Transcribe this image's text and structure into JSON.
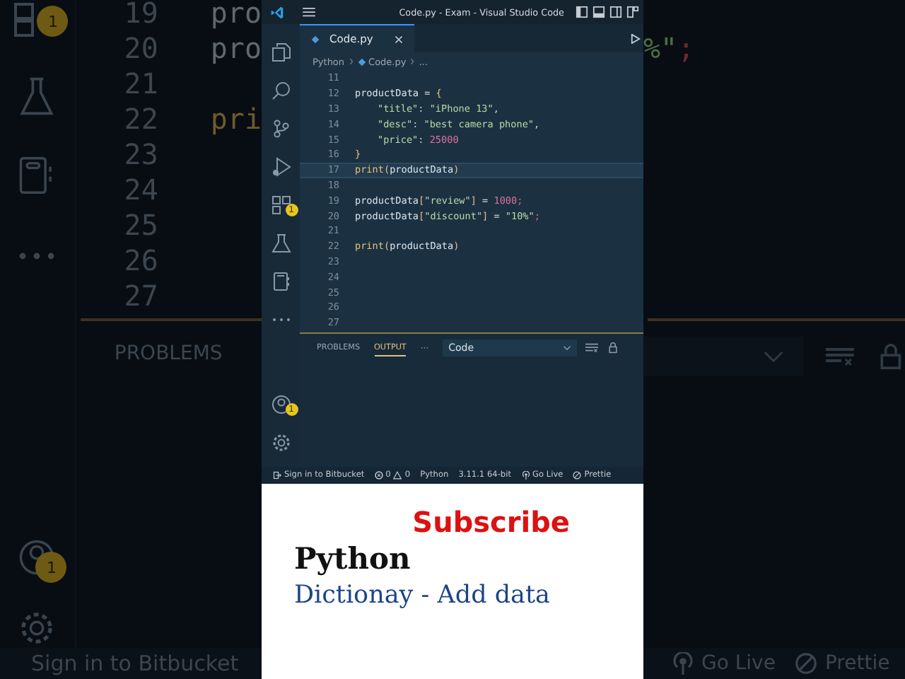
{
  "backdrop": {
    "left": {
      "badges": [
        "1",
        "1"
      ],
      "lines": [
        {
          "number": "19",
          "code": "pro",
          "kind": "id"
        },
        {
          "number": "20",
          "code": "pro",
          "kind": "id"
        },
        {
          "number": "21"
        },
        {
          "number": "22",
          "code": "pri",
          "kind": "fn"
        },
        {
          "number": "23"
        },
        {
          "number": "24"
        },
        {
          "number": "25"
        },
        {
          "number": "26"
        },
        {
          "number": "27"
        }
      ],
      "panel_tab": "PROBLEMS",
      "status": "Sign in to Bitbucket"
    },
    "right": {
      "code": [
        {
          "text": "%\"",
          "kind": "str"
        },
        {
          "text": ";",
          "kind": "err"
        }
      ],
      "status": [
        "Go Live",
        "Prettie"
      ]
    }
  },
  "window": {
    "title": "Code.py - Exam - Visual Studio Code"
  },
  "activity_bar": [
    {
      "kind": "files"
    },
    {
      "kind": "search"
    },
    {
      "kind": "source-control"
    },
    {
      "kind": "run"
    },
    {
      "kind": "extensions",
      "badge": "1"
    },
    {
      "kind": "testing"
    },
    {
      "kind": "notebook"
    },
    {
      "kind": "more"
    }
  ],
  "activity_bottom": [
    {
      "kind": "account",
      "badge": "1"
    },
    {
      "kind": "settings"
    }
  ],
  "tabs": [
    {
      "label": "Code.py",
      "selected": true
    }
  ],
  "breadcrumb": [
    "Python",
    "Code.py",
    "..."
  ],
  "editor": {
    "lines": [
      {
        "number": "11",
        "selected": false
      },
      {
        "number": "12",
        "selected": false,
        "indent": false,
        "tokens": [
          {
            "t": "productData",
            "kind": "id"
          },
          {
            "t": " = ",
            "kind": "op"
          },
          {
            "t": "{",
            "kind": "br"
          }
        ]
      },
      {
        "number": "13",
        "selected": false,
        "indent": true,
        "tokens": [
          {
            "t": "\"title\"",
            "kind": "str"
          },
          {
            "t": ": ",
            "kind": "op"
          },
          {
            "t": "\"iPhone 13\"",
            "kind": "str"
          },
          {
            "t": ",",
            "kind": "op"
          }
        ]
      },
      {
        "number": "14",
        "selected": false,
        "indent": true,
        "tokens": [
          {
            "t": "\"desc\"",
            "kind": "str"
          },
          {
            "t": ": ",
            "kind": "op"
          },
          {
            "t": "\"best camera phone\"",
            "kind": "str"
          },
          {
            "t": ",",
            "kind": "op"
          }
        ]
      },
      {
        "number": "15",
        "selected": false,
        "indent": true,
        "tokens": [
          {
            "t": "\"price\"",
            "kind": "str"
          },
          {
            "t": ": ",
            "kind": "op"
          },
          {
            "t": "25000",
            "kind": "num"
          }
        ]
      },
      {
        "number": "16",
        "selected": false,
        "indent": false,
        "tokens": [
          {
            "t": "}",
            "kind": "br"
          }
        ]
      },
      {
        "number": "17",
        "selected": true,
        "indent": false,
        "tokens": [
          {
            "t": "print",
            "kind": "fn"
          },
          {
            "t": "(",
            "kind": "br"
          },
          {
            "t": "productData",
            "kind": "id"
          },
          {
            "t": ")",
            "kind": "br"
          }
        ]
      },
      {
        "number": "18",
        "selected": false
      },
      {
        "number": "19",
        "selected": false,
        "indent": false,
        "tokens": [
          {
            "t": "productData",
            "kind": "id"
          },
          {
            "t": "[",
            "kind": "br"
          },
          {
            "t": "\"review\"",
            "kind": "str"
          },
          {
            "t": "]",
            "kind": "br"
          },
          {
            "t": " = ",
            "kind": "op"
          },
          {
            "t": "1000",
            "kind": "num"
          },
          {
            "t": ";",
            "kind": "err"
          }
        ]
      },
      {
        "number": "20",
        "selected": false,
        "indent": false,
        "tokens": [
          {
            "t": "productData",
            "kind": "id"
          },
          {
            "t": "[",
            "kind": "br"
          },
          {
            "t": "\"discount\"",
            "kind": "str"
          },
          {
            "t": "]",
            "kind": "br"
          },
          {
            "t": " = ",
            "kind": "op"
          },
          {
            "t": "\"10%\"",
            "kind": "str"
          },
          {
            "t": ";",
            "kind": "err"
          }
        ]
      },
      {
        "number": "21",
        "selected": false
      },
      {
        "number": "22",
        "selected": false,
        "indent": false,
        "tokens": [
          {
            "t": "print",
            "kind": "fn"
          },
          {
            "t": "(",
            "kind": "br"
          },
          {
            "t": "productData",
            "kind": "id"
          },
          {
            "t": ")",
            "kind": "br"
          }
        ]
      },
      {
        "number": "23",
        "selected": false
      },
      {
        "number": "24",
        "selected": false
      },
      {
        "number": "25",
        "selected": false
      },
      {
        "number": "26",
        "selected": false
      },
      {
        "number": "27",
        "selected": false
      }
    ]
  },
  "panel": {
    "tabs": [
      {
        "label": "PROBLEMS",
        "selected": false
      },
      {
        "label": "OUTPUT",
        "selected": true
      }
    ],
    "more": "···",
    "dropdown": "Code"
  },
  "status_bar": [
    {
      "kind": "account",
      "text": "Sign in to Bitbucket"
    },
    {
      "kind": "problems",
      "errors": "0",
      "warnings": "0"
    },
    {
      "kind": "text",
      "text": "Python"
    },
    {
      "kind": "text",
      "text": "3.11.1 64-bit"
    },
    {
      "kind": "live",
      "text": "Go Live"
    },
    {
      "kind": "prettier",
      "text": "Prettie"
    }
  ],
  "caption": {
    "subscribe": "Subscribe",
    "title": "Python",
    "subtitle": "Dictionay - Add data"
  }
}
